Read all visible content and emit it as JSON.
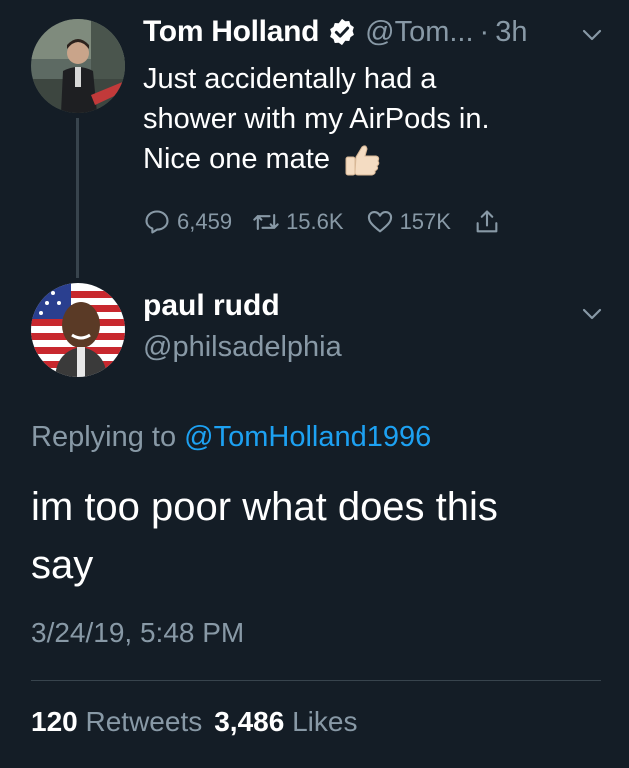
{
  "original_tweet": {
    "author_name": "Tom Holland",
    "handle": "@Tom...",
    "separator": "·",
    "time": "3h",
    "text_lines": [
      "Just accidentally had a",
      "shower with my AirPods in.",
      "Nice one mate"
    ],
    "emoji": "thumbs-up-icon",
    "reply_count": "6,459",
    "retweet_count": "15.6K",
    "like_count": "157K",
    "verified": true
  },
  "reply_tweet": {
    "author_name": "paul rudd",
    "handle": "@philsadelphia",
    "replying_prefix": "Replying to",
    "replying_mention": "@TomHolland1996",
    "text_lines": [
      "im too poor what does this",
      "say"
    ],
    "timestamp": "3/24/19, 5:48 PM",
    "retweets_count": "120",
    "retweets_label": "Retweets",
    "likes_count": "3,486",
    "likes_label": "Likes"
  },
  "colors": {
    "background": "#141d26",
    "primary_text": "#ffffff",
    "secondary_text": "#8899a6",
    "accent": "#1da1f2",
    "divider": "#38444d"
  }
}
